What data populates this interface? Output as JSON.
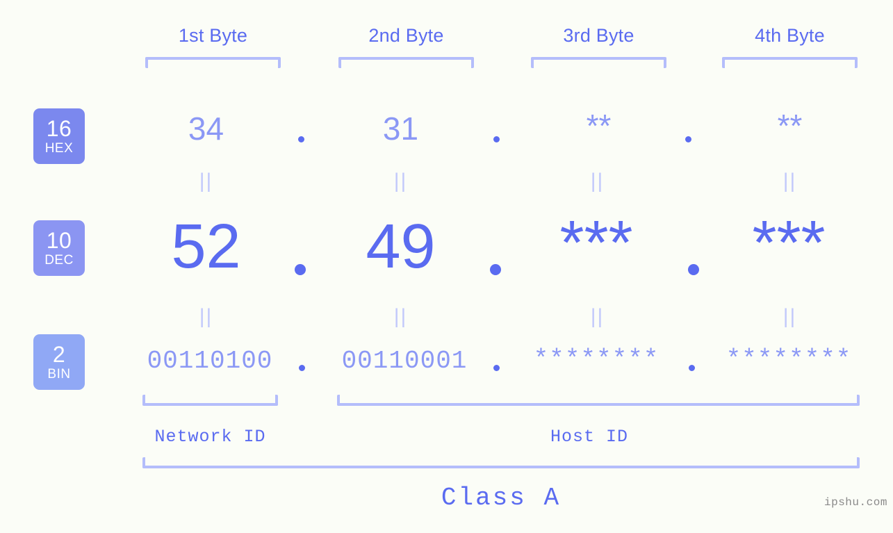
{
  "meta": {
    "watermark": "ipshu.com",
    "background_color": "#fbfdf7",
    "accent_strong": "#5a6bf0",
    "accent_mid": "#8b98f5",
    "accent_light": "#b4bdfb"
  },
  "byte_headers": [
    {
      "label": "1st Byte"
    },
    {
      "label": "2nd Byte"
    },
    {
      "label": "3rd Byte"
    },
    {
      "label": "4th Byte"
    }
  ],
  "bases": [
    {
      "number": "16",
      "name": "HEX",
      "color": "#7b88ee"
    },
    {
      "number": "10",
      "name": "DEC",
      "color": "#8b95f2"
    },
    {
      "number": "2",
      "name": "BIN",
      "color": "#90a8f5"
    }
  ],
  "rows": {
    "hex": {
      "values": [
        "34",
        "31",
        "**",
        "**"
      ]
    },
    "dec": {
      "values": [
        "52",
        "49",
        "***",
        "***"
      ]
    },
    "bin": {
      "values": [
        "00110100",
        "00110001",
        "********",
        "********"
      ]
    }
  },
  "separators": {
    "symbol": "."
  },
  "equality": {
    "symbol": "||"
  },
  "sections": [
    {
      "label": "Network ID"
    },
    {
      "label": "Host ID"
    }
  ],
  "class": {
    "label": "Class A"
  }
}
